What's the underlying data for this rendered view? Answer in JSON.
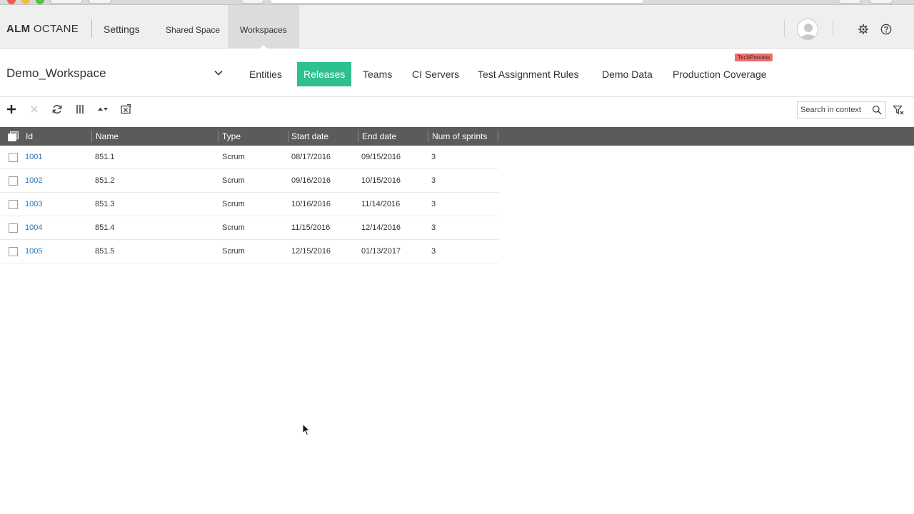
{
  "app": {
    "logo_bold": "ALM",
    "logo_rest": " OCTANE",
    "section_title": "Settings"
  },
  "top_tabs": [
    {
      "label": "Shared Space",
      "active": false
    },
    {
      "label": "Workspaces",
      "active": true
    }
  ],
  "workspace": {
    "name": "Demo_Workspace"
  },
  "sub_tabs": [
    {
      "label": "Entities",
      "active": false
    },
    {
      "label": "Releases",
      "active": true
    },
    {
      "label": "Teams",
      "active": false
    },
    {
      "label": "CI Servers",
      "active": false
    },
    {
      "label": "Test Assignment Rules",
      "active": false
    },
    {
      "label": "Demo Data",
      "active": false
    },
    {
      "label": "Production Coverage",
      "active": false,
      "badge": "TechPreview"
    }
  ],
  "toolbar": {
    "search_placeholder": "Search in context",
    "icons": [
      "add-icon",
      "delete-icon",
      "refresh-icon",
      "columns-icon",
      "sort-icon",
      "export-icon",
      "search-icon",
      "filter-icon"
    ]
  },
  "grid": {
    "columns": [
      "Id",
      "Name",
      "Type",
      "Start date",
      "End date",
      "Num of sprints"
    ],
    "rows": [
      {
        "id": "1001",
        "name": "851.1",
        "type": "Scrum",
        "start": "08/17/2016",
        "end": "09/15/2016",
        "sprints": "3"
      },
      {
        "id": "1002",
        "name": "851.2",
        "type": "Scrum",
        "start": "09/16/2016",
        "end": "10/15/2016",
        "sprints": "3"
      },
      {
        "id": "1003",
        "name": "851.3",
        "type": "Scrum",
        "start": "10/16/2016",
        "end": "11/14/2016",
        "sprints": "3"
      },
      {
        "id": "1004",
        "name": "851.4",
        "type": "Scrum",
        "start": "11/15/2016",
        "end": "12/14/2016",
        "sprints": "3"
      },
      {
        "id": "1005",
        "name": "851.5",
        "type": "Scrum",
        "start": "12/15/2016",
        "end": "01/13/2017",
        "sprints": "3"
      }
    ]
  },
  "colors": {
    "active_tab": "#2ec08d",
    "grid_header": "#5b5b5b",
    "id_link": "#2a76b8",
    "badge": "#ee6e6e"
  }
}
